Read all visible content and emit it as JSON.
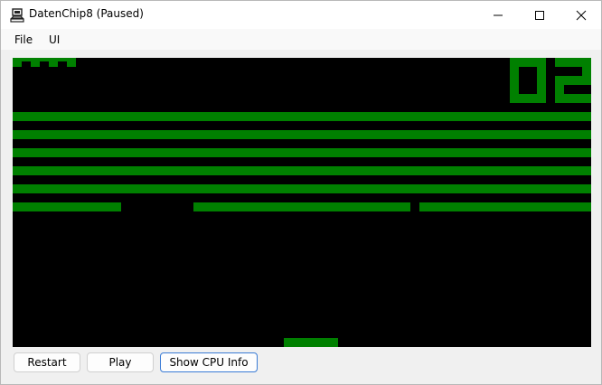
{
  "window": {
    "title": "DatenChip8 (Paused)"
  },
  "titlebar": {
    "icons": [
      "app-icon",
      "minimize-icon",
      "maximize-icon",
      "close-icon"
    ]
  },
  "menu": {
    "file_label": "File",
    "ui_label": "UI"
  },
  "emulator": {
    "pixel_color": "#008000",
    "background_color": "#000000",
    "score_display": "02",
    "lives_remaining": 3,
    "brick_rows_full": 5,
    "brick_row_partial_segments": 3
  },
  "controls": {
    "restart_label": "Restart",
    "play_label": "Play",
    "cpu_info_label": "Show CPU Info"
  }
}
